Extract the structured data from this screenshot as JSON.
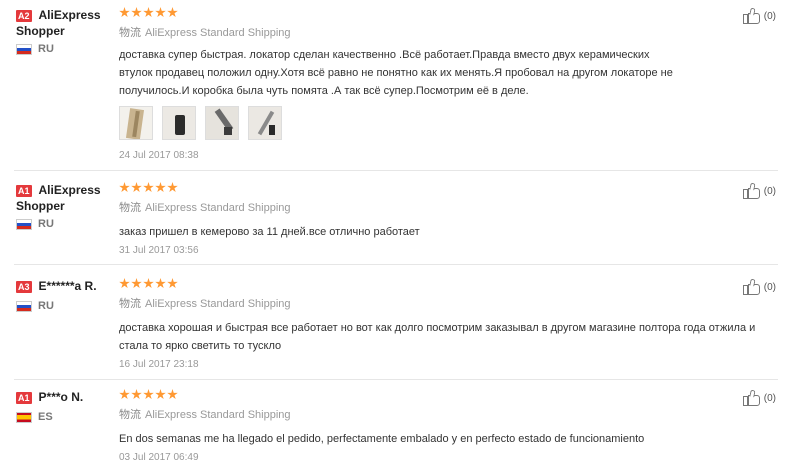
{
  "star_color": "#ff9933",
  "level_badge_color": "#e4393c",
  "reviews": [
    {
      "level": "A2",
      "user_line1": "AliExpress",
      "user_line2": "Shopper",
      "flag": "ru",
      "country": "RU",
      "stars": 5,
      "shipping_cn": "物流",
      "shipping": "AliExpress Standard Shipping",
      "text": "доставка супер быстрая. локатор сделан качественно .Всё работает.Правда вместо двух керамических втулок продавец положил одну.Хотя всё равно не понятно как их менять.Я пробовал на другом локаторе не получилось.И коробка была чуть помята .А так всё супер.Посмотрим её в деле.",
      "photos": [
        "photo-1",
        "photo-2",
        "photo-3",
        "photo-4"
      ],
      "date": "24 Jul 2017 08:38",
      "helpful": "(0)"
    },
    {
      "level": "A1",
      "user_line1": "AliExpress",
      "user_line2": "Shopper",
      "flag": "ru",
      "country": "RU",
      "stars": 5,
      "shipping_cn": "物流",
      "shipping": "AliExpress Standard Shipping",
      "text": "заказ пришел в кемерово за 11 дней.все отлично работает",
      "date": "31 Jul 2017 03:56",
      "helpful": "(0)"
    },
    {
      "level": "A3",
      "user_line1": "E******a R.",
      "flag": "ru",
      "country": "RU",
      "stars": 5,
      "shipping_cn": "物流",
      "shipping": "AliExpress Standard Shipping",
      "text": "доставка хорошая и быстрая все работает но вот как долго посмотрим заказывал в другом магазине полтора года отжила и стала то ярко светить то тускло",
      "date": "16 Jul 2017 23:18",
      "helpful": "(0)"
    },
    {
      "level": "A1",
      "user_line1": "P***o N.",
      "flag": "es",
      "country": "ES",
      "stars": 5,
      "shipping_cn": "物流",
      "shipping": "AliExpress Standard Shipping",
      "text": "En dos semanas me ha llegado el pedido, perfectamente embalado y en perfecto estado de funcionamiento",
      "date": "03 Jul 2017 06:49",
      "helpful": "(0)"
    }
  ]
}
